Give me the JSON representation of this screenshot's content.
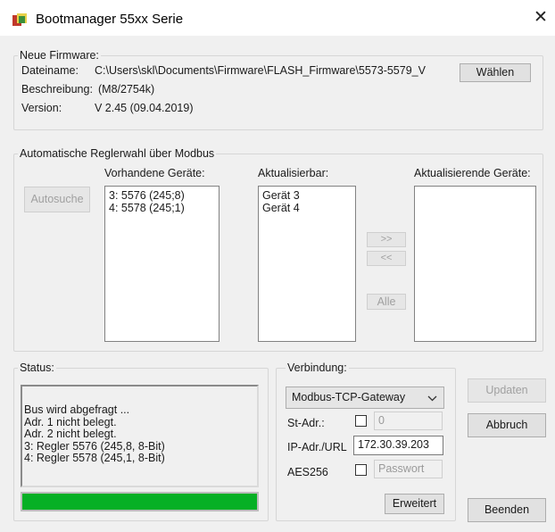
{
  "window": {
    "title": "Bootmanager 55xx Serie",
    "close_glyph": "✕"
  },
  "firmware": {
    "group_label": "Neue Firmware:",
    "file_label": "Dateiname:",
    "file_value": "C:\\Users\\skl\\Documents\\Firmware\\FLASH_Firmware\\5573-5579_V",
    "choose_button": "Wählen",
    "description_label": "Beschreibung:",
    "description_value": "(M8/2754k)",
    "version_label": "Version:",
    "version_value": "V 2.45 (09.04.2019)"
  },
  "modbus": {
    "group_label": "Automatische Reglerwahl über Modbus",
    "autosearch_button": "Autosuche",
    "available_label": "Vorhandene Geräte:",
    "available_items": [
      "3: 5576 (245;8)",
      "4: 5578 (245;1)"
    ],
    "updatable_label": "Aktualisierbar:",
    "updatable_items": [
      "Gerät  3",
      "Gerät  4"
    ],
    "updating_label": "Aktualisierende Geräte:",
    "move_right_button": ">>",
    "move_left_button": "<<",
    "all_button": "Alle"
  },
  "status": {
    "group_label": "Status:",
    "log_lines": [
      "Bus wird abgefragt ...",
      "Adr. 1 nicht belegt.",
      "Adr. 2 nicht belegt.",
      "3: Regler 5576 (245,8, 8-Bit)",
      "4: Regler 5578 (245,1, 8-Bit)"
    ],
    "progress_fraction": 1.0,
    "progress_color": "#06b025"
  },
  "connection": {
    "group_label": "Verbindung:",
    "mode_value": "Modbus-TCP-Gateway",
    "st_addr_label": "St-Adr.:",
    "st_addr_value": "0",
    "ip_label": "IP-Adr./URL",
    "ip_value": "172.30.39.203",
    "aes_label": "AES256",
    "password_placeholder": "Passwort",
    "advanced_button": "Erweitert"
  },
  "actions": {
    "update_button": "Updaten",
    "abort_button": "Abbruch",
    "exit_button": "Beenden"
  }
}
